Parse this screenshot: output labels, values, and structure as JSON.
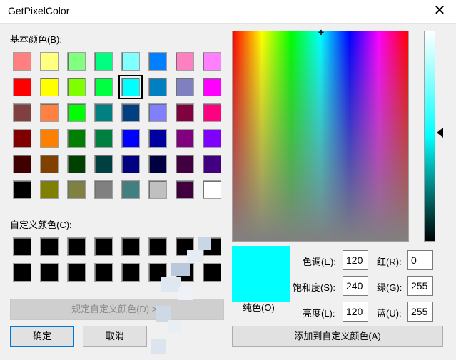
{
  "window": {
    "title": "GetPixelColor",
    "close_glyph": "✕"
  },
  "basic": {
    "label": "基本颜色(B):",
    "colors": [
      "#ff8080",
      "#ffff80",
      "#80ff80",
      "#00ff80",
      "#80ffff",
      "#0080ff",
      "#ff80c0",
      "#ff80ff",
      "#ff0000",
      "#ffff00",
      "#80ff00",
      "#00ff40",
      "#00ffff",
      "#0080c0",
      "#8080c0",
      "#ff00ff",
      "#804040",
      "#ff8040",
      "#00ff00",
      "#008080",
      "#004080",
      "#8080ff",
      "#800040",
      "#ff0080",
      "#800000",
      "#ff8000",
      "#008000",
      "#008040",
      "#0000ff",
      "#0000a0",
      "#800080",
      "#8000ff",
      "#400000",
      "#804000",
      "#004000",
      "#004040",
      "#000080",
      "#000040",
      "#400040",
      "#400080",
      "#000000",
      "#808000",
      "#808040",
      "#808080",
      "#408080",
      "#c0c0c0",
      "#400040",
      "#ffffff"
    ],
    "selected_index": 12
  },
  "custom": {
    "label": "自定义颜色(C):",
    "colors": [
      "#000000",
      "#000000",
      "#000000",
      "#000000",
      "#000000",
      "#000000",
      "#000000",
      "#000000",
      "#000000",
      "#000000",
      "#000000",
      "#000000",
      "#000000",
      "#000000",
      "#000000",
      "#000000"
    ]
  },
  "buttons": {
    "define_custom": "规定自定义颜色(D) >>",
    "ok": "确定",
    "cancel": "取消",
    "add_custom": "添加到自定义颜色(A)"
  },
  "fields": {
    "hue": {
      "label": "色调(E):",
      "value": "120"
    },
    "sat": {
      "label": "饱和度(S):",
      "value": "240"
    },
    "lum": {
      "label": "亮度(L):",
      "value": "120"
    },
    "red": {
      "label": "红(R):",
      "value": "0"
    },
    "green": {
      "label": "绿(G):",
      "value": "255"
    },
    "blue": {
      "label": "蓝(U):",
      "value": "255"
    }
  },
  "preview": {
    "label": "纯色(O)",
    "color": "#00ffff"
  }
}
